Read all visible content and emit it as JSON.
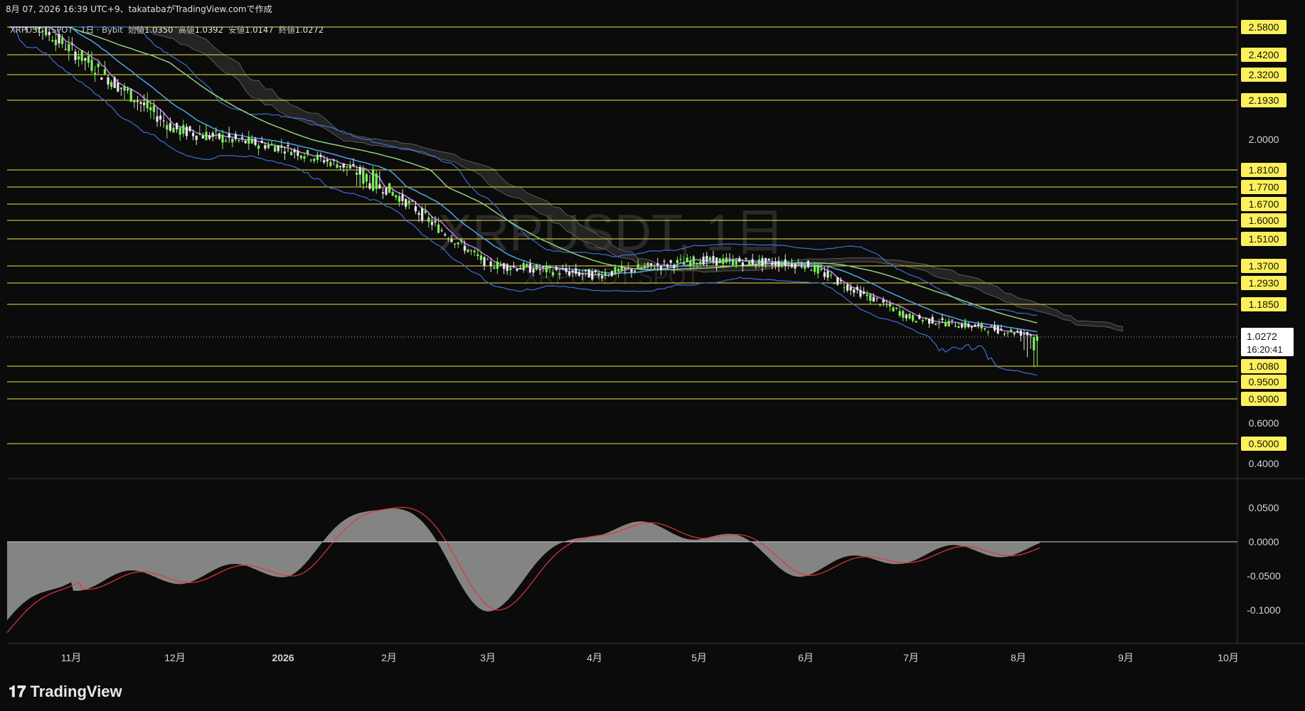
{
  "header": {
    "caption": "8月 07, 2026 16:39 UTC+9、takatabaがTradingView.comで作成"
  },
  "legend": {
    "symbol": "XRPUSDT SPOT · 1日 · Bybit",
    "open_label": "始値",
    "open": "1.0350",
    "high_label": "高値",
    "high": "1.0392",
    "low_label": "安値",
    "low": "1.0147",
    "close_label": "終値",
    "close": "1.0272"
  },
  "watermark": {
    "title": "XRPUSDT, 1日",
    "subtitle": "XRPUSDT SPOT"
  },
  "last_price": {
    "value": "1.0272",
    "countdown": "16:20:41"
  },
  "logo_text": "TradingView",
  "colors": {
    "background": "#0b0b0b",
    "level_line": "#f0e04a",
    "level_badge": "#fdf15b",
    "up_candle": "#7cf05a",
    "down_candle": "#e8e8e8",
    "bollinger": "#3f6fd6",
    "ma_short": "#c07ee6",
    "ma_mid": "#4fa3e8",
    "ma_long": "#8ed07a",
    "cloud": "#3b3b3b",
    "oscillator": "#9a9a9a",
    "signal": "#e8333a"
  },
  "icons": {
    "logo": "tradingview-logo-icon"
  },
  "chart_data": [
    {
      "type": "line",
      "title": "XRPUSDT, 1日",
      "price_axis_ticks": [
        "2.5800",
        "2.4200",
        "2.3200",
        "2.1930",
        "2.0000",
        "1.8100",
        "1.7700",
        "1.6700",
        "1.6000",
        "1.5100",
        "1.3700",
        "1.2930",
        "1.1850",
        "1.0080",
        "0.9500",
        "0.9000",
        "0.6000",
        "0.5000",
        "0.4000"
      ],
      "highlighted_levels": [
        2.58,
        2.42,
        2.32,
        2.193,
        1.81,
        1.77,
        1.67,
        1.6,
        1.51,
        1.37,
        1.293,
        1.185,
        1.008,
        0.95,
        0.9,
        0.5
      ],
      "time_axis_ticks": [
        "11月",
        "12月",
        "2026",
        "2月",
        "3月",
        "4月",
        "5月",
        "6月",
        "7月",
        "8月",
        "9月",
        "10月"
      ],
      "series": [
        {
          "x": [
            "11月",
            "12月",
            "2026",
            "2月",
            "3月",
            "4月",
            "5月",
            "6月",
            "7月",
            "8月"
          ],
          "values": [
            2.45,
            2.05,
            1.95,
            1.75,
            1.38,
            1.33,
            1.4,
            1.38,
            1.12,
            1.05
          ]
        }
      ],
      "last_close": 1.0272
    },
    {
      "type": "area",
      "price_axis_ticks": [
        "0.0500",
        "0.0000",
        "-0.0500",
        "-0.1000"
      ],
      "ylim": [
        -0.125,
        0.07
      ],
      "series": [
        {
          "x": [
            "11月",
            "12月",
            "2026",
            "2月",
            "3月",
            "4月",
            "5月",
            "6月",
            "7月",
            "8月"
          ],
          "values": [
            -0.06,
            -0.05,
            -0.04,
            0.06,
            -0.09,
            0.02,
            0.015,
            -0.04,
            -0.02,
            -0.01
          ]
        }
      ]
    }
  ]
}
